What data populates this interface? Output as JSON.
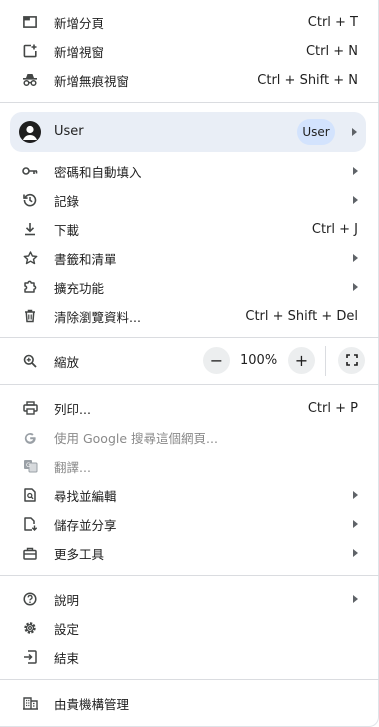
{
  "group1": [
    {
      "label": "新增分頁",
      "shortcut": "Ctrl + T",
      "icon": "new-tab-icon"
    },
    {
      "label": "新增視窗",
      "shortcut": "Ctrl + N",
      "icon": "new-window-icon"
    },
    {
      "label": "新增無痕視窗",
      "shortcut": "Ctrl + Shift + N",
      "icon": "incognito-icon"
    }
  ],
  "profile": {
    "name": "User",
    "badge": "User",
    "icon": "account-icon"
  },
  "group2": [
    {
      "label": "密碼和自動填入",
      "icon": "key-icon",
      "submenu": true
    },
    {
      "label": "記錄",
      "icon": "history-icon",
      "submenu": true
    },
    {
      "label": "下載",
      "shortcut": "Ctrl + J",
      "icon": "download-icon"
    },
    {
      "label": "書籤和清單",
      "icon": "star-icon",
      "submenu": true
    },
    {
      "label": "擴充功能",
      "icon": "extension-icon",
      "submenu": true
    },
    {
      "label": "清除瀏覽資料...",
      "shortcut": "Ctrl + Shift + Del",
      "icon": "trash-icon"
    }
  ],
  "zoom": {
    "label": "縮放",
    "value": "100%",
    "minus": "−",
    "plus": "+",
    "icon": "zoom-icon"
  },
  "group3": [
    {
      "label": "列印...",
      "shortcut": "Ctrl + P",
      "icon": "print-icon"
    },
    {
      "label": "使用 Google 搜尋這個網頁...",
      "icon": "google-icon",
      "disabled": true
    },
    {
      "label": "翻譯...",
      "icon": "translate-icon",
      "disabled": true
    },
    {
      "label": "尋找並編輯",
      "icon": "find-edit-icon",
      "submenu": true
    },
    {
      "label": "儲存並分享",
      "icon": "save-share-icon",
      "submenu": true
    },
    {
      "label": "更多工具",
      "icon": "toolbox-icon",
      "submenu": true
    }
  ],
  "group4": [
    {
      "label": "說明",
      "icon": "help-icon",
      "submenu": true
    },
    {
      "label": "設定",
      "icon": "settings-icon"
    },
    {
      "label": "結束",
      "icon": "exit-icon"
    }
  ],
  "managed": {
    "label": "由貴機構管理",
    "icon": "building-icon"
  },
  "colors": {
    "accent": "#d3e3fd",
    "profile_bg": "#e9eef6",
    "separator": "#dadce0",
    "icon": "#444746"
  }
}
